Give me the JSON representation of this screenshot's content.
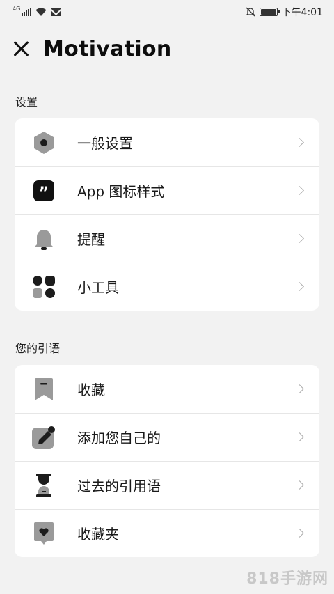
{
  "status_bar": {
    "network": "4G",
    "time": "下午4:01"
  },
  "header": {
    "title": "Motivation"
  },
  "sections": [
    {
      "label": "设置",
      "items": [
        {
          "label": "一般设置",
          "icon": "settings-hex-icon"
        },
        {
          "label": "App 图标样式",
          "icon": "quote-app-icon"
        },
        {
          "label": "提醒",
          "icon": "bell-icon"
        },
        {
          "label": "小工具",
          "icon": "widgets-icon"
        }
      ]
    },
    {
      "label": "您的引语",
      "items": [
        {
          "label": "收藏",
          "icon": "bookmark-icon"
        },
        {
          "label": "添加您自己的",
          "icon": "edit-pencil-icon"
        },
        {
          "label": "过去的引用语",
          "icon": "hourglass-icon"
        },
        {
          "label": "收藏夹",
          "icon": "heart-folder-icon"
        }
      ]
    }
  ],
  "watermark": "818手游网"
}
